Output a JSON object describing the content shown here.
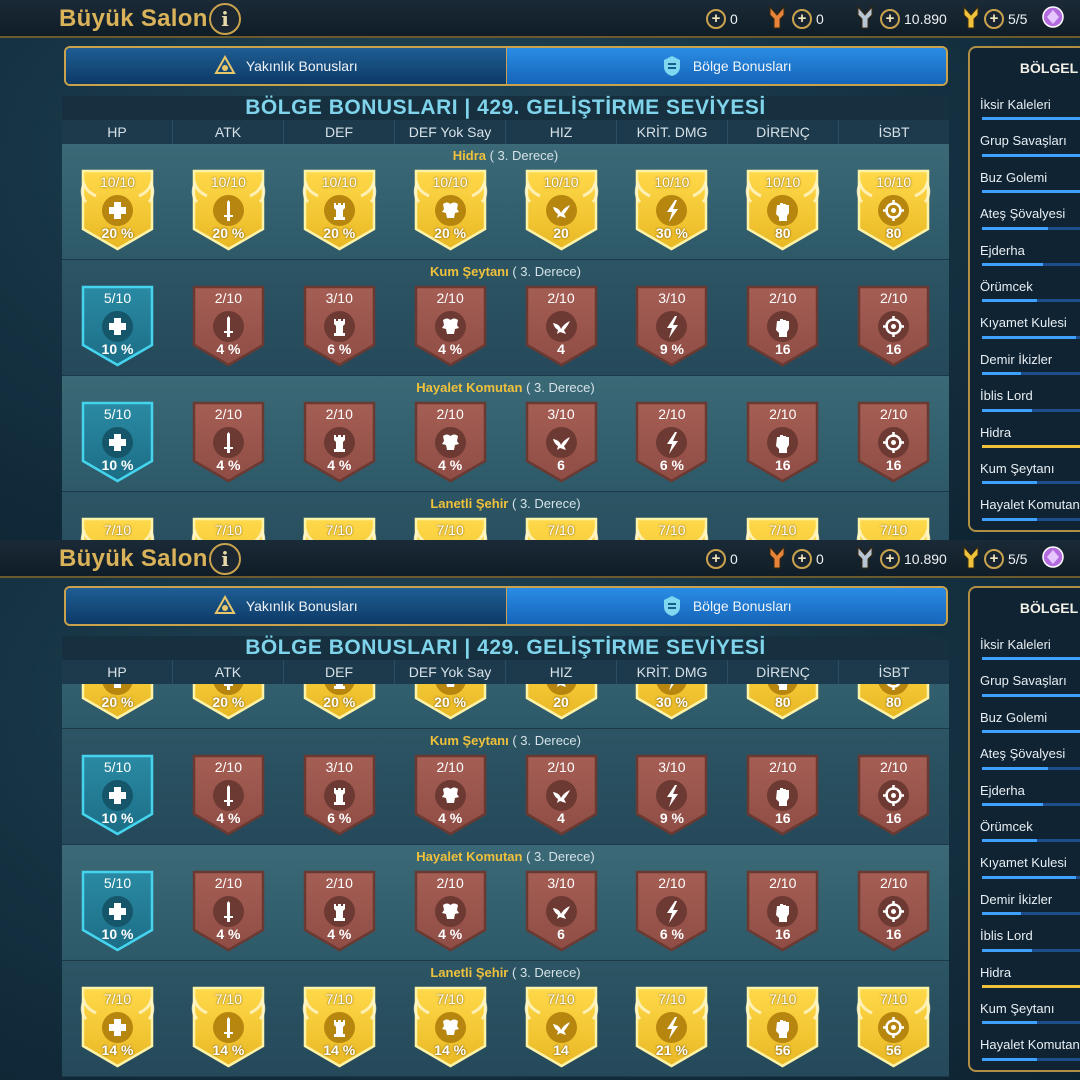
{
  "header": {
    "title": "Büyük Salon",
    "info_label": "i"
  },
  "resources": [
    {
      "plus": "+",
      "value": "0",
      "icon": "orange-key-icon",
      "color": "#e8833a"
    },
    {
      "plus": "+",
      "value": "0",
      "icon": "silver-key-icon",
      "color": "#b8c6d6"
    },
    {
      "plus": "+",
      "value": "10.890",
      "icon": "gold-key-icon",
      "color": "#f0c13b"
    },
    {
      "plus": "+",
      "value": "5/5",
      "icon": "purple-gem-icon",
      "color": "#b46be0"
    }
  ],
  "tabs": [
    {
      "label": "Yakınlık Bonusları",
      "icon": "affinity-icon",
      "active": false
    },
    {
      "label": "Bölge Bonusları",
      "icon": "area-icon",
      "active": true
    }
  ],
  "table": {
    "title": "BÖLGE BONUSLARI | 429. GELİŞTİRME SEVİYESİ",
    "columns": [
      "HP",
      "ATK",
      "DEF",
      "DEF Yok Say",
      "HIZ",
      "KRİT. DMG",
      "DİRENÇ",
      "İSBT"
    ],
    "icons": [
      "hp-cross-icon",
      "atk-sword-icon",
      "def-tower-icon",
      "ignore-def-icon",
      "spd-bird-icon",
      "crit-dmg-bolt-icon",
      "res-fist-icon",
      "acc-target-icon"
    ],
    "rows": [
      {
        "name": "Hidra",
        "grade": "( 3. Derece)",
        "cells": [
          {
            "level": "10/10",
            "value": "20 %",
            "tier": "gold"
          },
          {
            "level": "10/10",
            "value": "20 %",
            "tier": "gold"
          },
          {
            "level": "10/10",
            "value": "20 %",
            "tier": "gold"
          },
          {
            "level": "10/10",
            "value": "20 %",
            "tier": "gold"
          },
          {
            "level": "10/10",
            "value": "20",
            "tier": "gold"
          },
          {
            "level": "10/10",
            "value": "30 %",
            "tier": "gold"
          },
          {
            "level": "10/10",
            "value": "80",
            "tier": "gold"
          },
          {
            "level": "10/10",
            "value": "80",
            "tier": "gold"
          }
        ]
      },
      {
        "name": "Kum Şeytanı",
        "grade": "( 3. Derece)",
        "cells": [
          {
            "level": "5/10",
            "value": "10 %",
            "tier": "blue"
          },
          {
            "level": "2/10",
            "value": "4 %",
            "tier": "bronze"
          },
          {
            "level": "3/10",
            "value": "6 %",
            "tier": "bronze"
          },
          {
            "level": "2/10",
            "value": "4 %",
            "tier": "bronze"
          },
          {
            "level": "2/10",
            "value": "4",
            "tier": "bronze"
          },
          {
            "level": "3/10",
            "value": "9 %",
            "tier": "bronze"
          },
          {
            "level": "2/10",
            "value": "16",
            "tier": "bronze"
          },
          {
            "level": "2/10",
            "value": "16",
            "tier": "bronze"
          }
        ]
      },
      {
        "name": "Hayalet Komutan",
        "grade": "( 3. Derece)",
        "cells": [
          {
            "level": "5/10",
            "value": "10 %",
            "tier": "blue"
          },
          {
            "level": "2/10",
            "value": "4 %",
            "tier": "bronze"
          },
          {
            "level": "2/10",
            "value": "4 %",
            "tier": "bronze"
          },
          {
            "level": "2/10",
            "value": "4 %",
            "tier": "bronze"
          },
          {
            "level": "3/10",
            "value": "6",
            "tier": "bronze"
          },
          {
            "level": "2/10",
            "value": "6 %",
            "tier": "bronze"
          },
          {
            "level": "2/10",
            "value": "16",
            "tier": "bronze"
          },
          {
            "level": "2/10",
            "value": "16",
            "tier": "bronze"
          }
        ]
      },
      {
        "name": "Lanetli Şehir",
        "grade": "( 3. Derece)",
        "cells": [
          {
            "level": "7/10",
            "value": "14 %",
            "tier": "gold"
          },
          {
            "level": "7/10",
            "value": "14 %",
            "tier": "gold"
          },
          {
            "level": "7/10",
            "value": "14 %",
            "tier": "gold"
          },
          {
            "level": "7/10",
            "value": "14 %",
            "tier": "gold"
          },
          {
            "level": "7/10",
            "value": "14",
            "tier": "gold"
          },
          {
            "level": "7/10",
            "value": "21 %",
            "tier": "gold"
          },
          {
            "level": "7/10",
            "value": "56",
            "tier": "gold"
          },
          {
            "level": "7/10",
            "value": "56",
            "tier": "gold"
          }
        ]
      }
    ]
  },
  "side_panel": {
    "title": "BÖLGEL",
    "items": [
      {
        "label": "İksir Kaleleri",
        "progress": 1.0,
        "highlight": false
      },
      {
        "label": "Grup Savaşları",
        "progress": 1.0,
        "highlight": false
      },
      {
        "label": "Buz Golemi",
        "progress": 0.9,
        "highlight": false
      },
      {
        "label": "Ateş Şövalyesi",
        "progress": 0.6,
        "highlight": false
      },
      {
        "label": "Ejderha",
        "progress": 0.55,
        "highlight": false
      },
      {
        "label": "Örümcek",
        "progress": 0.5,
        "highlight": false
      },
      {
        "label": "Kıyamet Kulesi",
        "progress": 0.85,
        "highlight": false
      },
      {
        "label": "Demir İkizler",
        "progress": 0.35,
        "highlight": false
      },
      {
        "label": "İblis Lord",
        "progress": 0.45,
        "highlight": false
      },
      {
        "label": "Hidra",
        "progress": 1.0,
        "highlight": true
      },
      {
        "label": "Kum Şeytanı",
        "progress": 0.5,
        "highlight": false
      },
      {
        "label": "Hayalet Komutan",
        "progress": 0.5,
        "highlight": false
      }
    ]
  },
  "panes": [
    {
      "name": "top-pane",
      "scroll_rows": 0
    },
    {
      "name": "bottom-pane",
      "scroll_rows": 0.61
    }
  ]
}
